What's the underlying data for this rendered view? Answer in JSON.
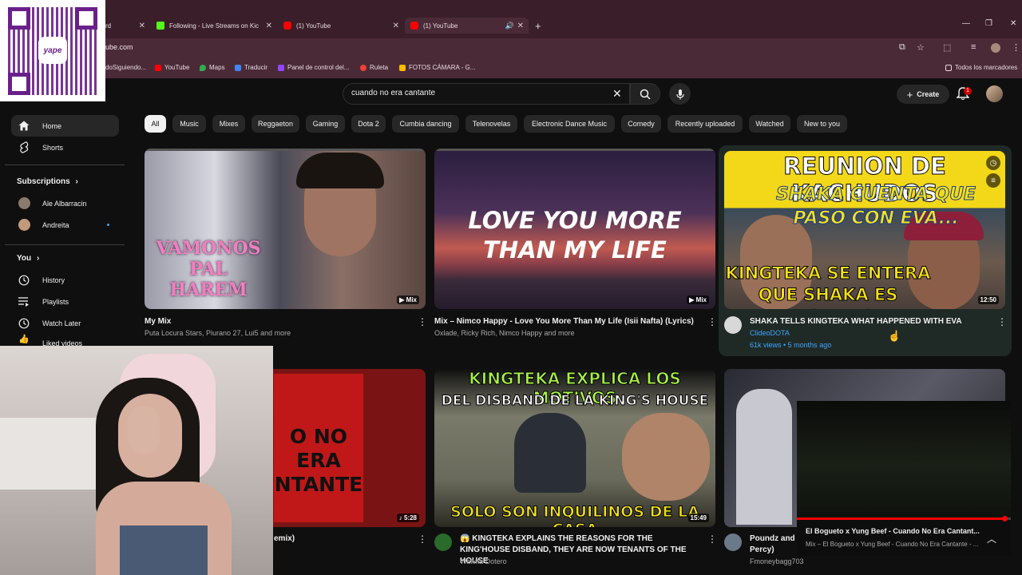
{
  "browser": {
    "tabs": [
      {
        "label": "rd"
      },
      {
        "label": "Following - Live Streams on Kic"
      },
      {
        "label": "(1) YouTube"
      },
      {
        "label": "(1) YouTube"
      }
    ],
    "new_tab": "+",
    "url": "ube.com",
    "bookmarks": [
      {
        "label": "doSiguiendo..."
      },
      {
        "label": "YouTube"
      },
      {
        "label": "Maps"
      },
      {
        "label": "Traducir"
      },
      {
        "label": "Panel de control del..."
      },
      {
        "label": "Ruleta"
      },
      {
        "label": "FOTOS CÁMARA - G..."
      }
    ],
    "all_bookmarks": "Todos los marcadores"
  },
  "overlay": {
    "qr_brand": "yape"
  },
  "header": {
    "search_value": "cuando no era cantante",
    "create_label": "Create",
    "notification_count": "1"
  },
  "chips": [
    "All",
    "Music",
    "Mixes",
    "Reggaeton",
    "Gaming",
    "Dota 2",
    "Cumbia dancing",
    "Telenovelas",
    "Electronic Dance Music",
    "Comedy",
    "Recently uploaded",
    "Watched",
    "New to you"
  ],
  "sidebar": {
    "home": "Home",
    "shorts": "Shorts",
    "subscriptions_heading": "Subscriptions",
    "subscriptions": [
      {
        "label": "Ale Albarracin"
      },
      {
        "label": "Andreita"
      }
    ],
    "you_heading": "You",
    "you_items": [
      {
        "label": "History"
      },
      {
        "label": "Playlists"
      },
      {
        "label": "Watch Later"
      },
      {
        "label": "Liked videos"
      }
    ]
  },
  "videos": [
    {
      "title": "My Mix",
      "meta": "Puta Locura Stars, Piurano 27, Lui5 and more",
      "badge": "Mix",
      "thumb_text": "VAMONOS PAL HAREM"
    },
    {
      "title": "Mix – Nimco Happy - Love You More Than My Life (Isii Nafta) (Lyrics)",
      "meta": "Oxlade, Ricky Rich, Nimco Happy and more",
      "badge": "Mix",
      "thumb_text": "LOVE YOU MORE THAN MY LIFE"
    },
    {
      "title": "SHAKA TELLS KINGTEKA WHAT HAPPENED WITH EVA",
      "channel": "ClideoDOTA",
      "meta": "61k views • 5 months ago",
      "badge": "12:50",
      "thumb_top": "REUNION DE KACHUDOS",
      "thumb_mid": "SHAKA CUENTA QUE PASO CON EVA...",
      "thumb_bottom": "KINGTEKA SE ENTERA QUE SHAKA ES KACHUDO"
    },
    {
      "title": "emix)",
      "badge": "5:28",
      "thumb_text": "O NO ERA NTANTE"
    },
    {
      "title": "😱 KINGTEKA EXPLAINS THE REASONS FOR THE KING'HOUSE DISBAND, THEY ARE NOW TENANTS OF THE HOUSE",
      "channel": "Wawita Dotero",
      "badge": "15:49",
      "thumb_top": "KINGTEKA EXPLICA LOS MOTIVOS",
      "thumb_mid": "DEL DISBAND DE LA KING'S HOUSE",
      "thumb_bottom": "SOLO SON INQUILINOS DE LA CASA"
    },
    {
      "title": "Poundz and Percy)",
      "channel": "Fmoneybagg703"
    }
  ],
  "miniplayer": {
    "title": "El Bogueto x Yung Beef - Cuando No Era Cantant...",
    "subtitle": "Mix – El Bogueto x Yung Beef - Cuando No Era Cantante - ..."
  },
  "colors": {
    "browser_frame": "#3a1e2a",
    "yt_bg": "#0f0f0f",
    "accent_red": "#ff0000",
    "link_blue": "#3ea6ff"
  }
}
